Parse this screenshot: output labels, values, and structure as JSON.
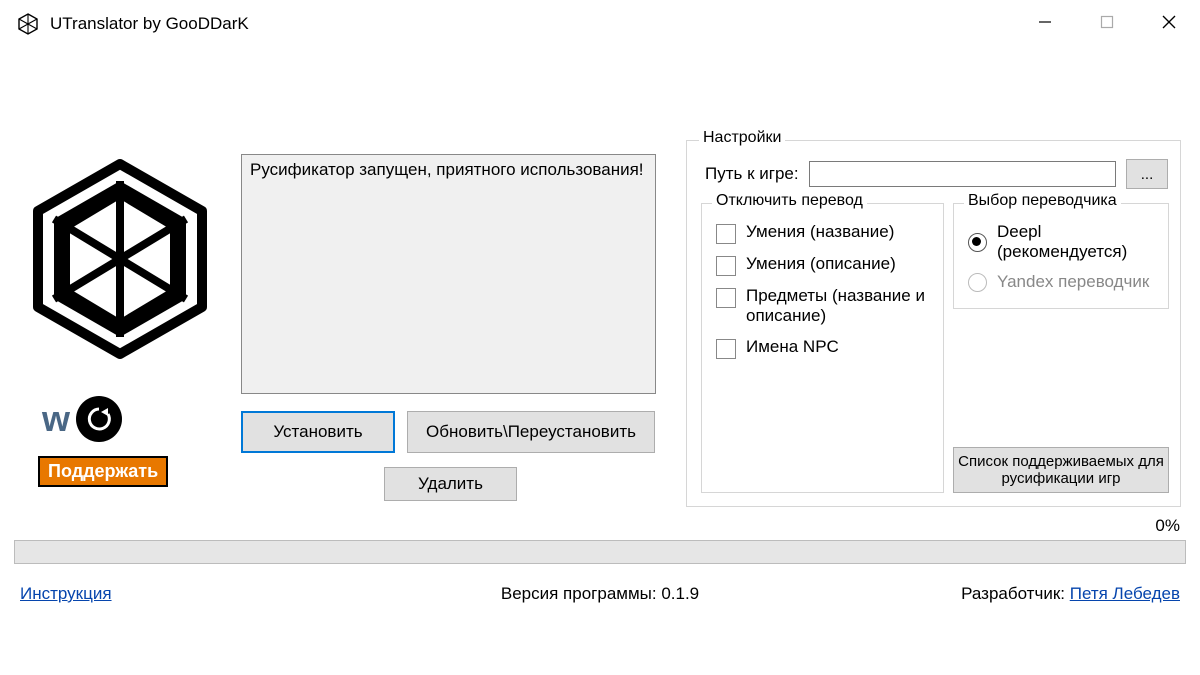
{
  "title": "UTranslator by GooDDarK",
  "log_message": "Русификатор запущен, приятного использования!",
  "buttons": {
    "install": "Установить",
    "update": "Обновить\\Переустановить",
    "delete": "Удалить",
    "support": "Поддержать",
    "supported_games": "Список поддерживаемых для русификации игр",
    "browse": "..."
  },
  "settings": {
    "legend": "Настройки",
    "path_label": "Путь к игре:",
    "path_value": "",
    "disable_group": {
      "legend": "Отключить перевод",
      "items": [
        {
          "label": "Умения (название)",
          "checked": false
        },
        {
          "label": "Умения (описание)",
          "checked": false
        },
        {
          "label": "Предметы (название и описание)",
          "checked": false
        },
        {
          "label": "Имена NPC",
          "checked": false
        }
      ]
    },
    "translator_group": {
      "legend": "Выбор переводчика",
      "options": [
        {
          "label": "Deepl (рекомендуется)",
          "checked": true,
          "enabled": true
        },
        {
          "label": "Yandex переводчик",
          "checked": false,
          "enabled": false
        }
      ]
    }
  },
  "progress": {
    "percent_text": "0%",
    "value": 0
  },
  "footer": {
    "instruction": "Инструкция",
    "version": "Версия программы: 0.1.9",
    "developer_label": "Разработчик: ",
    "developer_name": "Петя Лебедев"
  },
  "social": {
    "vk": "VK"
  }
}
